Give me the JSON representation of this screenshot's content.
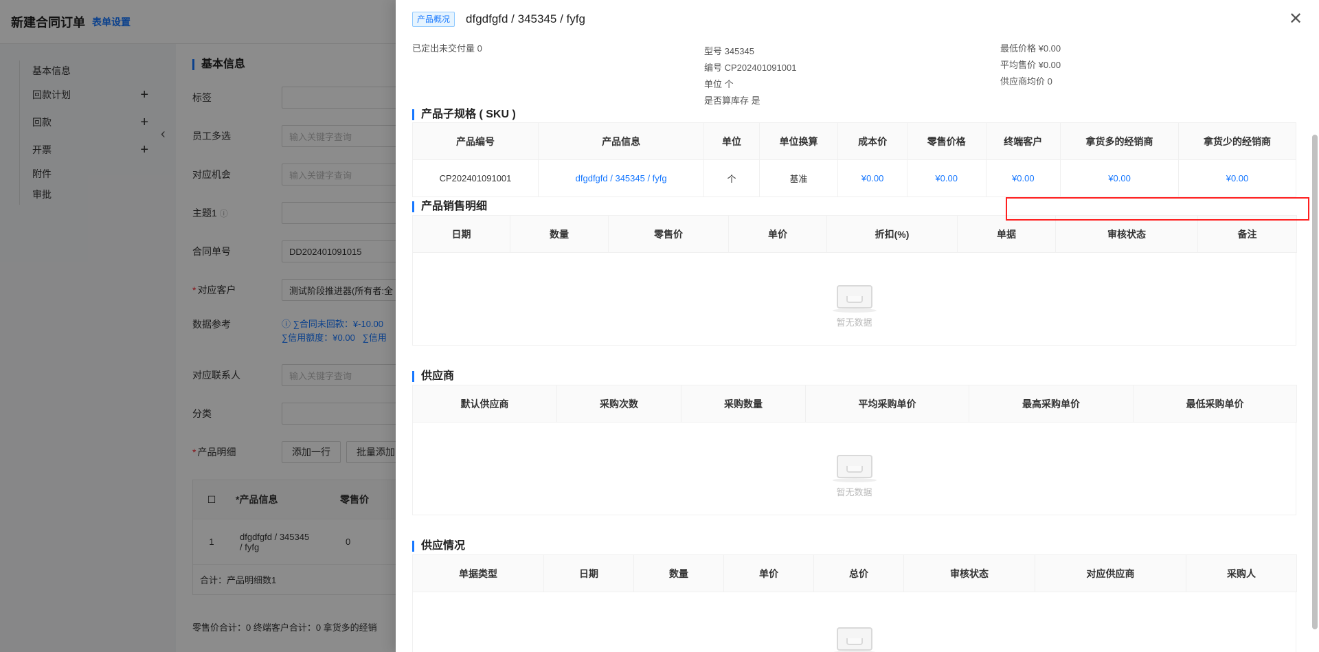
{
  "bg": {
    "title": "新建合同订单",
    "settings_link": "表单设置",
    "nav": [
      {
        "label": "基本信息",
        "plus": ""
      },
      {
        "label": "回款计划",
        "plus": "+"
      },
      {
        "label": "回款",
        "plus": "+"
      },
      {
        "label": "开票",
        "plus": "+"
      },
      {
        "label": "附件",
        "plus": ""
      },
      {
        "label": "审批",
        "plus": ""
      }
    ],
    "section_title": "基本信息",
    "fields": {
      "tag_label": "标签",
      "staff_label": "员工多选",
      "staff_placeholder": "输入关键字查询",
      "opportunity_label": "对应机会",
      "opportunity_placeholder": "输入关键字查询",
      "topic_label": "主题1",
      "contract_no_label": "合同单号",
      "contract_no_value": "DD202401091015",
      "customer_label": "对应客户",
      "customer_value": "测试阶段推进器(所有者:全",
      "data_ref_label": "数据参考",
      "data_ref_line1": "∑合同未回款：¥-10.00",
      "data_ref_line2a": "∑信用额度：¥0.00",
      "data_ref_line2b": "∑信用",
      "contact_label": "对应联系人",
      "contact_placeholder": "输入关键字查询",
      "category_label": "分类",
      "product_detail_label": "产品明细"
    },
    "buttons": {
      "add_row": "添加一行",
      "batch_add": "批量添加"
    },
    "table": {
      "headers": [
        "*产品信息",
        "零售价"
      ],
      "row": {
        "index": "1",
        "product": "dfgdfgfd / 345345 / fyfg",
        "price": "0"
      },
      "footer": "合计：产品明细数1"
    },
    "summary": "零售价合计：0  终端客户合计：0  拿货多的经销"
  },
  "drawer": {
    "tag": "产品概况",
    "title": "dfgdfgfd / 345345 / fyfg",
    "info": {
      "undelivered": "已定出未交付量 0",
      "model": "型号 345345",
      "code": "编号 CP202401091001",
      "unit": "单位 个",
      "stock": "是否算库存 是",
      "min_price": "最低价格 ¥0.00",
      "avg_price": "平均售价 ¥0.00",
      "supplier_avg": "供应商均价 0"
    },
    "sku": {
      "title": "产品子规格 ( SKU )",
      "headers": [
        "产品编号",
        "产品信息",
        "单位",
        "单位换算",
        "成本价",
        "零售价格",
        "终端客户",
        "拿货多的经销商",
        "拿货少的经销商"
      ],
      "rows": [
        [
          "CP202401091001",
          "dfgdfgfd / 345345 / fyfg",
          "个",
          "基准",
          "¥0.00",
          "¥0.00",
          "¥0.00",
          "¥0.00",
          "¥0.00"
        ]
      ]
    },
    "sales": {
      "title": "产品销售明细",
      "headers": [
        "日期",
        "数量",
        "零售价",
        "单价",
        "折扣(%)",
        "单据",
        "审核状态",
        "备注"
      ],
      "empty": "暂无数据"
    },
    "supplier": {
      "title": "供应商",
      "headers": [
        "默认供应商",
        "采购次数",
        "采购数量",
        "平均采购单价",
        "最高采购单价",
        "最低采购单价"
      ],
      "empty": "暂无数据"
    },
    "supply": {
      "title": "供应情况",
      "headers": [
        "单据类型",
        "日期",
        "数量",
        "单价",
        "总价",
        "审核状态",
        "对应供应商",
        "采购人"
      ]
    }
  }
}
